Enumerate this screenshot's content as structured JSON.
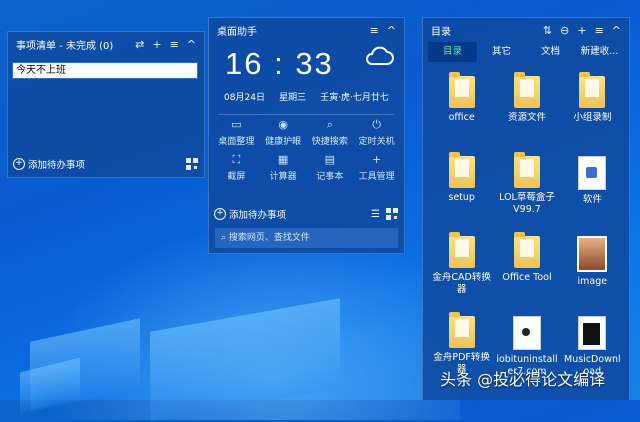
{
  "todo": {
    "title": "事项清单 - 未完成 (0)",
    "header_icons": [
      "⇄",
      "+",
      "≡",
      "^"
    ],
    "entry_value": "今天不上班",
    "add_label": "添加待办事项"
  },
  "assistant": {
    "title": "桌面助手",
    "time": "16 : 33",
    "date": "08月24日",
    "weekday": "星期三",
    "lunar": "壬寅·虎·七月廿七",
    "tools": [
      {
        "label": "桌面整理",
        "icon": "▭"
      },
      {
        "label": "健康护眼",
        "icon": "◉"
      },
      {
        "label": "快捷搜索",
        "icon": "⌕"
      },
      {
        "label": "定时关机",
        "icon": "⏻"
      },
      {
        "label": "截屏",
        "icon": "⛶"
      },
      {
        "label": "计算器",
        "icon": "▦"
      },
      {
        "label": "记事本",
        "icon": "▤"
      },
      {
        "label": "工具管理",
        "icon": "+"
      }
    ],
    "add_label": "添加待办事项",
    "search_placeholder": "搜索网页、查找文件"
  },
  "directory": {
    "title": "目录",
    "tabs": [
      "目录",
      "其它",
      "文档",
      "新建收..."
    ],
    "files": [
      {
        "name": "office",
        "kind": "folder"
      },
      {
        "name": "资源文件",
        "kind": "folder"
      },
      {
        "name": "小组录制",
        "kind": "folder"
      },
      {
        "name": "setup",
        "kind": "folder"
      },
      {
        "name": "LOL草莓盒子V99.7",
        "kind": "folder"
      },
      {
        "name": "软件",
        "kind": "doc2"
      },
      {
        "name": "金舟CAD转换器",
        "kind": "folder"
      },
      {
        "name": "Office Tool",
        "kind": "folder"
      },
      {
        "name": "image",
        "kind": "img"
      },
      {
        "name": "金舟PDF转换器",
        "kind": "folder"
      },
      {
        "name": "iobituninstaller7.com",
        "kind": "disc"
      },
      {
        "name": "MusicDownload",
        "kind": "black"
      }
    ]
  },
  "watermark": "头条 @投必得论文编译",
  "colors": {
    "accent_tab": "#5cf0b4",
    "widget_bg": "#0e4aa0"
  }
}
